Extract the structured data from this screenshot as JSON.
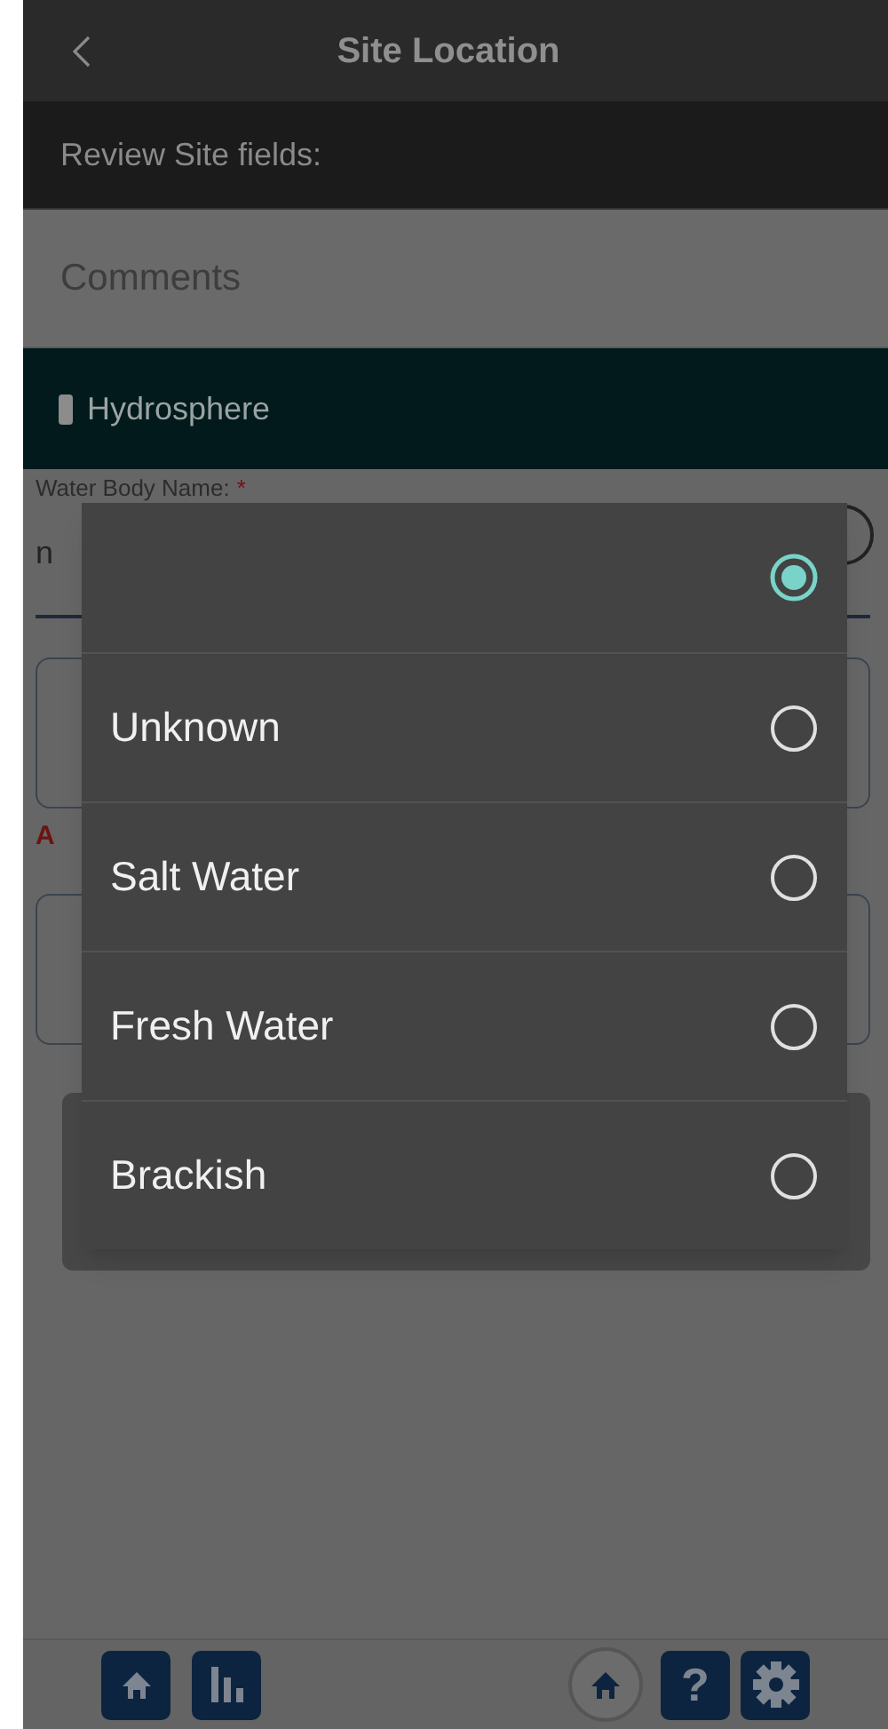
{
  "header": {
    "title": "Site Location"
  },
  "review_bar": {
    "label": "Review Site fields:"
  },
  "comments": {
    "label": "Comments"
  },
  "section": {
    "title": "Hydrosphere"
  },
  "field": {
    "label": "Water Body Name:",
    "required": "*",
    "value": "n",
    "error": "A"
  },
  "dialog": {
    "options": [
      {
        "selected": true
      },
      {
        "label": "Unknown",
        "selected": false
      },
      {
        "label": "Salt Water",
        "selected": false
      },
      {
        "label": "Fresh Water",
        "selected": false
      },
      {
        "label": "Brackish",
        "selected": false
      }
    ]
  },
  "bottom_bar": {
    "help": "?"
  }
}
